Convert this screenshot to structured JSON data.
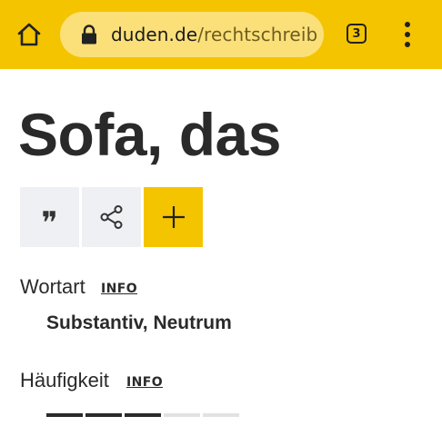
{
  "browser": {
    "url_domain": "duden.de",
    "url_path": "/rechtschreibu",
    "tab_count": "3",
    "accent_color": "#f5c400"
  },
  "entry": {
    "title": "Sofa, das",
    "actions": [
      {
        "name": "quote",
        "icon": "quote-icon"
      },
      {
        "name": "share",
        "icon": "share-icon"
      },
      {
        "name": "add",
        "icon": "plus-icon"
      }
    ],
    "wortart": {
      "label": "Wortart",
      "info": "INFO",
      "value": "Substantiv, Neutrum"
    },
    "haeufigkeit": {
      "label": "Häufigkeit",
      "info": "INFO",
      "level": 3,
      "max": 5
    }
  }
}
